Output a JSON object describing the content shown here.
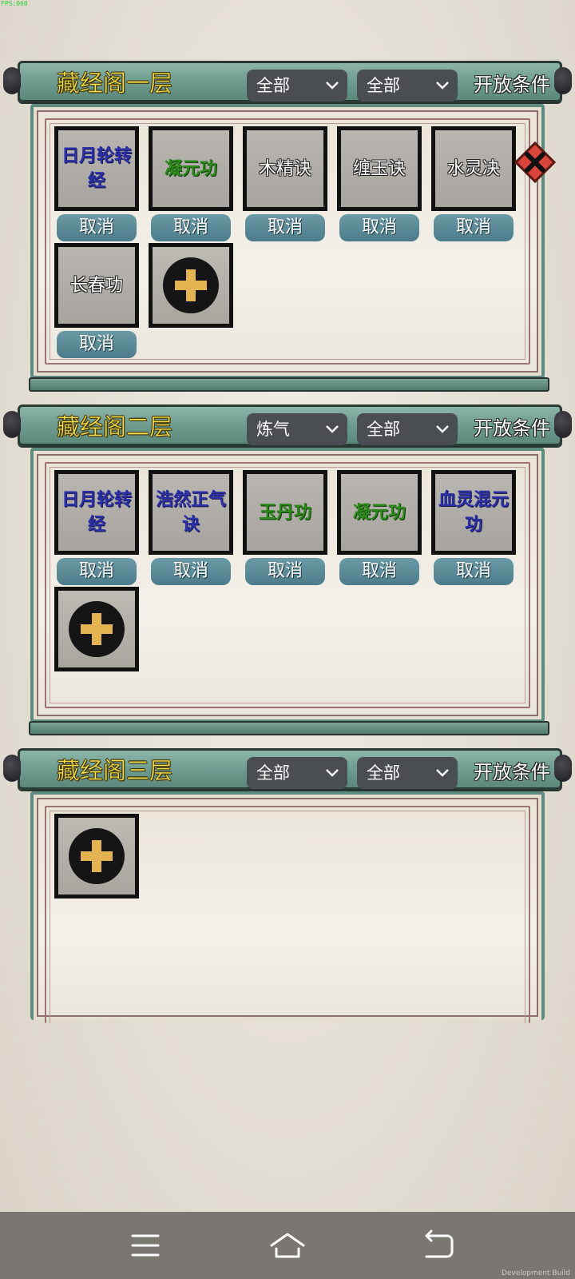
{
  "fps_label": "FPS:060",
  "open_condition_label": "开放条件",
  "cancel_label": "取消",
  "floors": [
    {
      "title": "藏经阁一层",
      "filter1": "全部",
      "filter2": "全部",
      "skills": [
        {
          "name": "日月轮转经",
          "line1": "日月轮转",
          "line2": "经",
          "color": "blue"
        },
        {
          "name": "凝元功",
          "line1": "凝元功",
          "line2": "",
          "color": "green"
        },
        {
          "name": "木精诀",
          "line1": "木精诀",
          "line2": "",
          "color": "white"
        },
        {
          "name": "缠玉诀",
          "line1": "缠玉诀",
          "line2": "",
          "color": "white"
        },
        {
          "name": "水灵决",
          "line1": "水灵决",
          "line2": "",
          "color": "white"
        },
        {
          "name": "长春功",
          "line1": "长春功",
          "line2": "",
          "color": "white"
        }
      ]
    },
    {
      "title": "藏经阁二层",
      "filter1": "炼气",
      "filter2": "全部",
      "skills": [
        {
          "name": "日月轮转经",
          "line1": "日月轮转",
          "line2": "经",
          "color": "blue"
        },
        {
          "name": "浩然正气诀",
          "line1": "浩然正气",
          "line2": "诀",
          "color": "blue"
        },
        {
          "name": "玉丹功",
          "line1": "玉丹功",
          "line2": "",
          "color": "green"
        },
        {
          "name": "凝元功",
          "line1": "凝元功",
          "line2": "",
          "color": "green"
        },
        {
          "name": "血灵混元功",
          "line1": "血灵混元",
          "line2": "功",
          "color": "blue"
        }
      ]
    },
    {
      "title": "藏经阁三层",
      "filter1": "全部",
      "filter2": "全部",
      "skills": []
    }
  ],
  "icons": {
    "add": "plus-icon",
    "close": "close-icon",
    "dropdown": "chevron-down-icon",
    "nav_menu": "menu-icon",
    "nav_home": "home-icon",
    "nav_back": "back-icon"
  },
  "colors": {
    "title_yellow": "#f4e24a",
    "skill_blue": "#2b2fa8",
    "skill_green": "#2c8a1c",
    "add_plus": "#e3b352",
    "close_red": "#d9443c"
  },
  "dev_build": "Development Build"
}
